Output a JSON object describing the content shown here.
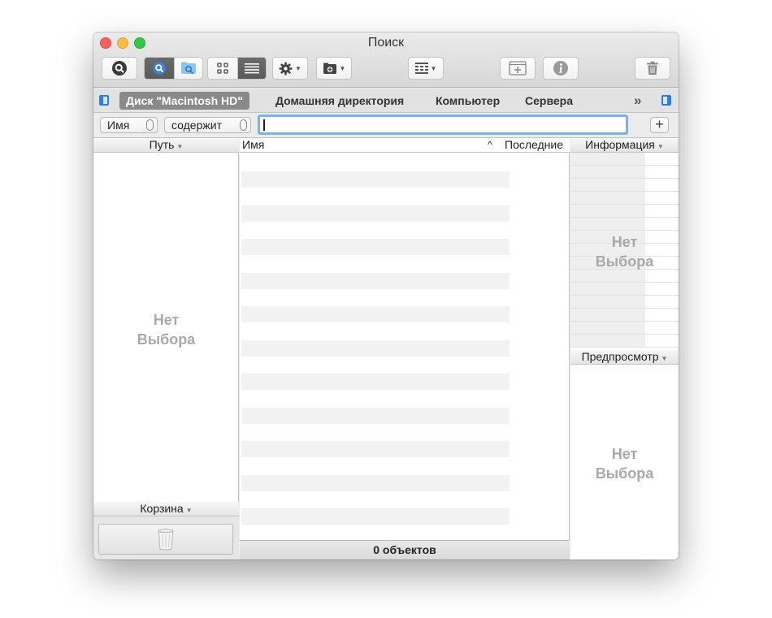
{
  "window": {
    "title": "Поиск"
  },
  "pathbar": {
    "items": [
      "Диск \"Macintosh HD\"",
      "Домашняя директория",
      "Компьютер",
      "Сервера"
    ],
    "overflow": "»"
  },
  "filter": {
    "field": "Имя",
    "operator": "содержит",
    "query": "",
    "add": "+"
  },
  "left": {
    "header": "Путь",
    "empty_line1": "Нет",
    "empty_line2": "Выбора",
    "trash_header": "Корзина"
  },
  "main": {
    "col_name": "Имя",
    "sort_indicator": "^",
    "col_last": "Последние",
    "status": "0 объектов"
  },
  "right": {
    "info_header": "Информация",
    "info_empty_line1": "Нет",
    "info_empty_line2": "Выбора",
    "preview_header": "Предпросмотр",
    "preview_empty_line1": "Нет",
    "preview_empty_line2": "Выбора"
  },
  "icons": {
    "search": "search-icon",
    "finder_search": "finder-search-icon",
    "icon_view": "icon-view-icon",
    "list_view": "list-view-icon",
    "gear": "gear-icon",
    "new_folder": "new-folder-icon",
    "arrange": "arrange-icon",
    "new_window": "new-window-icon",
    "info": "info-icon",
    "trash": "trash-icon"
  },
  "colors": {
    "accent": "#2a7de1",
    "focus_ring": "#7fb0ec",
    "active_segment": "#606060"
  }
}
